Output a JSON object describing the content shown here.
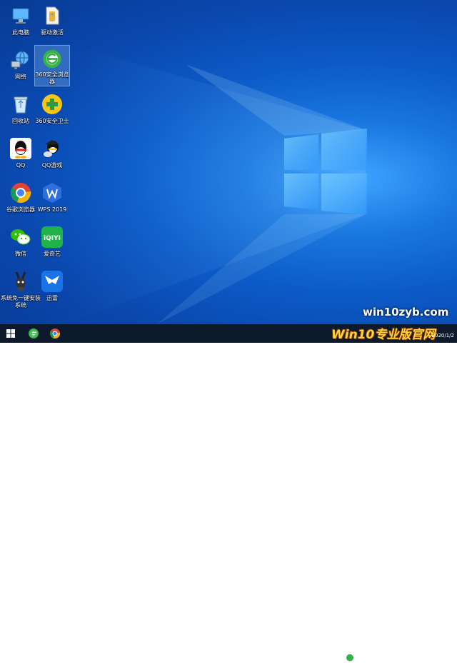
{
  "desktop": {
    "icons": [
      {
        "label": "此电脑",
        "icon": "this-pc-icon"
      },
      {
        "label": "驱动激活",
        "icon": "driver-activate-icon"
      },
      {
        "label": "网络",
        "icon": "network-icon"
      },
      {
        "label": "360安全浏览器",
        "icon": "360-browser-icon"
      },
      {
        "label": "回收站",
        "icon": "recycle-bin-icon"
      },
      {
        "label": "360安全卫士",
        "icon": "360-security-icon"
      },
      {
        "label": "QQ",
        "icon": "qq-icon"
      },
      {
        "label": "QQ游戏",
        "icon": "qq-game-icon"
      },
      {
        "label": "谷歌浏览器",
        "icon": "chrome-icon"
      },
      {
        "label": "WPS 2019",
        "icon": "wps-icon"
      },
      {
        "label": "微信",
        "icon": "wechat-icon"
      },
      {
        "label": "爱奇艺",
        "icon": "iqiyi-icon"
      },
      {
        "label": "系统免一键安装系统",
        "icon": "system-installer-icon"
      },
      {
        "label": "迅雷",
        "icon": "xunlei-icon"
      }
    ],
    "selected_icon": "360安全浏览器",
    "watermark_site": "win10zyb.com",
    "watermark_brand": "Win10专业版官网"
  },
  "taskbar": {
    "items": [
      "start-icon",
      "360-browser-icon",
      "chrome-icon"
    ],
    "clock_time": "",
    "clock_date": "2020/1/2"
  },
  "colors": {
    "taskbar": "#0c1a2c",
    "wallpaper_accent": "#3fa3ff",
    "selection": "#99d1ff"
  }
}
